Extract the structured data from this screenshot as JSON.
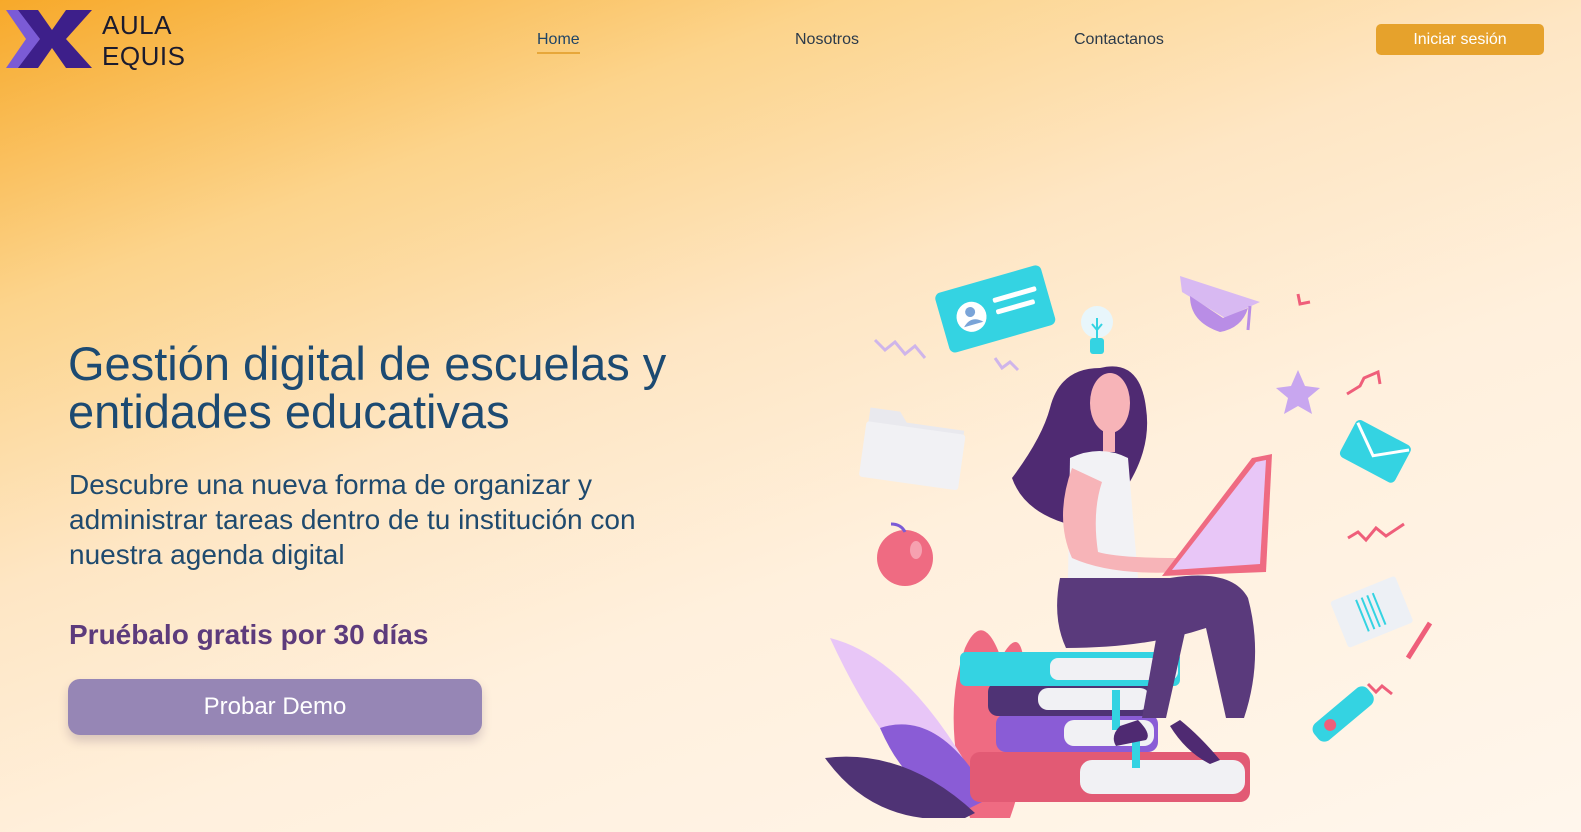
{
  "brand": {
    "line1": "AULA",
    "line2": "EQUIS"
  },
  "nav": {
    "home": "Home",
    "about": "Nosotros",
    "contact": "Contactanos",
    "login": "Iniciar sesión"
  },
  "hero": {
    "title": "Gestión digital de escuelas y entidades educativas",
    "subtitle": "Descubre una nueva forma de organizar y administrar tareas dentro de tu institución con nuestra agenda digital",
    "trial": "Pruébalo gratis por 30 días",
    "cta": "Probar Demo"
  },
  "colors": {
    "accent": "#e6a22c",
    "title": "#1c4a72",
    "purple": "#5d3b7c",
    "button": "#9686b5"
  }
}
